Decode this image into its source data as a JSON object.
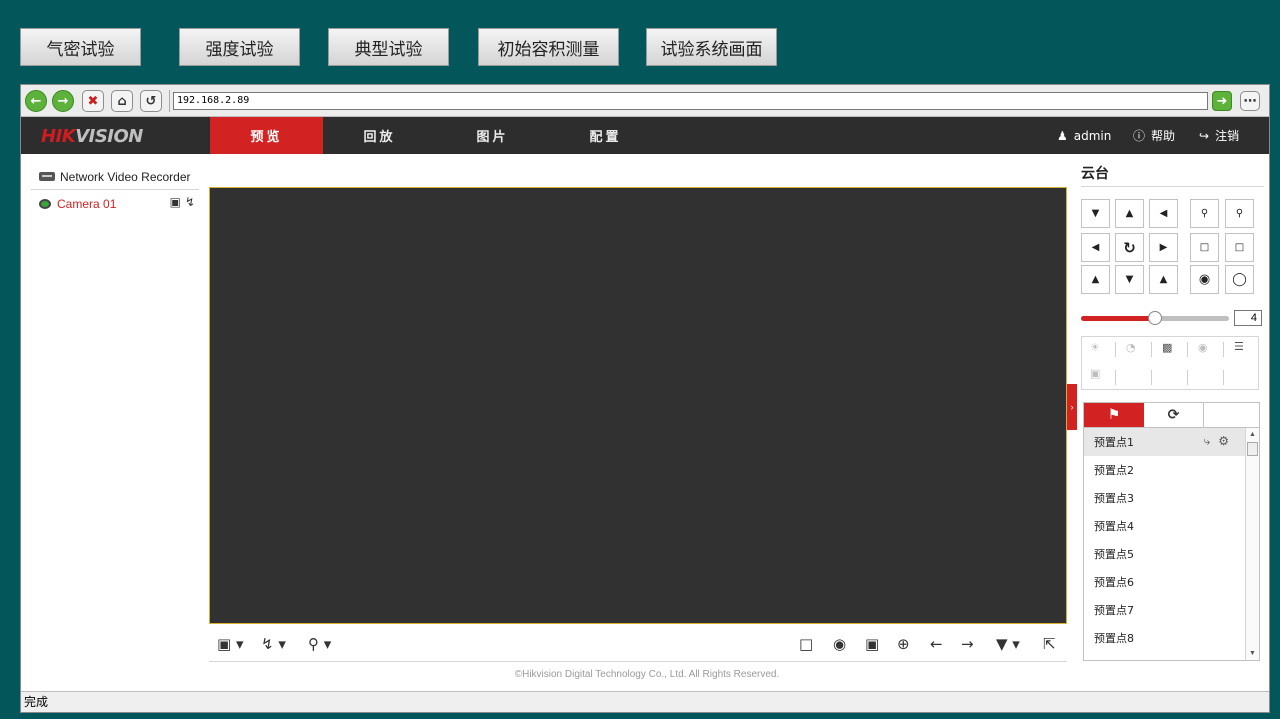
{
  "top_buttons": [
    "气密试验",
    "强度试验",
    "典型试验",
    "初始容积测量",
    "试验系统画面"
  ],
  "browser": {
    "url": "192.168.2.89",
    "status": "完成"
  },
  "header": {
    "logo_main": "HIK",
    "logo_sub": "VISION",
    "nav": [
      "预览",
      "回放",
      "图片",
      "配置"
    ],
    "active_nav": "预览",
    "user": "admin",
    "help": "帮助",
    "logout": "注销"
  },
  "sidebar": {
    "device": "Network Video Recorder",
    "camera": "Camera 01"
  },
  "ptz": {
    "title": "云台",
    "speed": "4",
    "speed_fraction": 0.5
  },
  "presets": [
    "预置点1",
    "预置点2",
    "预置点3",
    "预置点4",
    "预置点5",
    "预置点6",
    "预置点7",
    "预置点8"
  ],
  "footer": {
    "copyright": "©Hikvision Digital Technology Co., Ltd. All Rights Reserved."
  },
  "colors": {
    "accent": "#d32222",
    "background": "#03575a",
    "header": "#2d2d2d"
  }
}
